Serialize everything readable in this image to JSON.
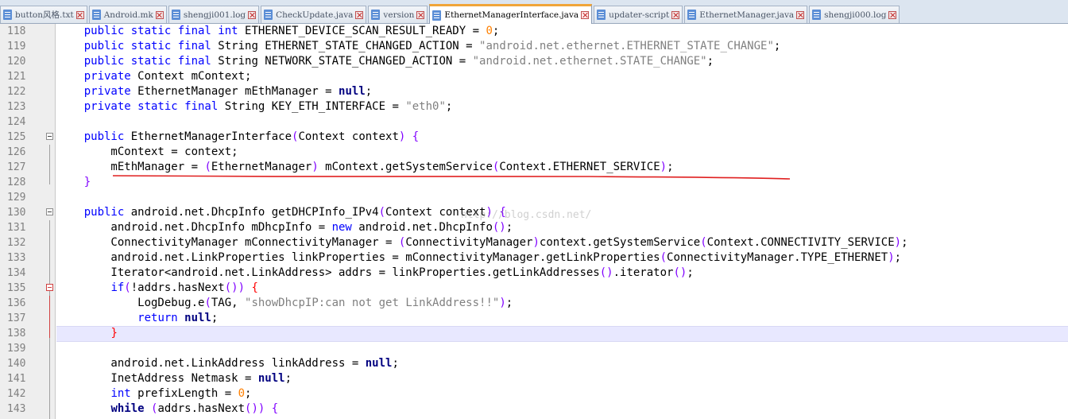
{
  "tabs": [
    {
      "label": "button风格.txt",
      "active": false
    },
    {
      "label": "Android.mk",
      "active": false
    },
    {
      "label": "shengji001.log",
      "active": false
    },
    {
      "label": "CheckUpdate.java",
      "active": false
    },
    {
      "label": "version",
      "active": false
    },
    {
      "label": "EthernetManagerInterface.java",
      "active": true
    },
    {
      "label": "updater-script",
      "active": false
    },
    {
      "label": "EthernetManager.java",
      "active": false
    },
    {
      "label": "shengji000.log",
      "active": false
    }
  ],
  "lines": [
    {
      "n": "118",
      "tokens": [
        [
          "    ",
          ""
        ],
        [
          "public static final int ",
          "k"
        ],
        [
          "ETHERNET_DEVICE_SCAN_RESULT_READY = ",
          ""
        ],
        [
          "0",
          "n"
        ],
        [
          ";",
          ""
        ]
      ]
    },
    {
      "n": "119",
      "tokens": [
        [
          "    ",
          ""
        ],
        [
          "public static final ",
          "k"
        ],
        [
          "String ETHERNET_STATE_CHANGED_ACTION = ",
          ""
        ],
        [
          "\"android.net.ethernet.ETHERNET_STATE_CHANGE\"",
          "s"
        ],
        [
          ";",
          ""
        ]
      ]
    },
    {
      "n": "120",
      "tokens": [
        [
          "    ",
          ""
        ],
        [
          "public static final ",
          "k"
        ],
        [
          "String NETWORK_STATE_CHANGED_ACTION = ",
          ""
        ],
        [
          "\"android.net.ethernet.STATE_CHANGE\"",
          "s"
        ],
        [
          ";",
          ""
        ]
      ]
    },
    {
      "n": "121",
      "tokens": [
        [
          "    ",
          ""
        ],
        [
          "private ",
          "k"
        ],
        [
          "Context mContext;",
          ""
        ]
      ]
    },
    {
      "n": "122",
      "tokens": [
        [
          "    ",
          ""
        ],
        [
          "private ",
          "k"
        ],
        [
          "EthernetManager mEthManager = ",
          ""
        ],
        [
          "null",
          "kb"
        ],
        [
          ";",
          ""
        ]
      ]
    },
    {
      "n": "123",
      "tokens": [
        [
          "    ",
          ""
        ],
        [
          "private static final ",
          "k"
        ],
        [
          "String KEY_ETH_INTERFACE = ",
          ""
        ],
        [
          "\"eth0\"",
          "s"
        ],
        [
          ";",
          ""
        ]
      ]
    },
    {
      "n": "124",
      "tokens": []
    },
    {
      "n": "125",
      "tokens": [
        [
          "    ",
          ""
        ],
        [
          "public ",
          "k"
        ],
        [
          "EthernetManagerInterface",
          ""
        ],
        [
          "(",
          "br"
        ],
        [
          "Context context",
          ""
        ],
        [
          ")",
          "br"
        ],
        [
          " ",
          ""
        ],
        [
          "{",
          "br"
        ]
      ]
    },
    {
      "n": "126",
      "tokens": [
        [
          "        mContext = context;",
          ""
        ]
      ]
    },
    {
      "n": "127",
      "tokens": [
        [
          "        mEthManager = ",
          ""
        ],
        [
          "(",
          "br"
        ],
        [
          "EthernetManager",
          ""
        ],
        [
          ")",
          "br"
        ],
        [
          " mContext.getSystemService",
          ""
        ],
        [
          "(",
          "br"
        ],
        [
          "Context.ETHERNET_SERVICE",
          ""
        ],
        [
          ")",
          "br"
        ],
        [
          ";",
          ""
        ]
      ]
    },
    {
      "n": "128",
      "tokens": [
        [
          "    ",
          ""
        ],
        [
          "}",
          "br"
        ]
      ]
    },
    {
      "n": "129",
      "tokens": []
    },
    {
      "n": "130",
      "tokens": [
        [
          "    ",
          ""
        ],
        [
          "public ",
          "k"
        ],
        [
          "android.net.DhcpInfo getDHCPInfo_IPv4",
          ""
        ],
        [
          "(",
          "br"
        ],
        [
          "Context context",
          ""
        ],
        [
          ")",
          "br"
        ],
        [
          " ",
          ""
        ],
        [
          "{",
          "br"
        ]
      ]
    },
    {
      "n": "131",
      "tokens": [
        [
          "        android.net.DhcpInfo mDhcpInfo = ",
          ""
        ],
        [
          "new ",
          "k"
        ],
        [
          "android.net.DhcpInfo",
          ""
        ],
        [
          "()",
          "br"
        ],
        [
          ";",
          ""
        ]
      ]
    },
    {
      "n": "132",
      "tokens": [
        [
          "        ConnectivityManager mConnectivityManager = ",
          ""
        ],
        [
          "(",
          "br"
        ],
        [
          "ConnectivityManager",
          ""
        ],
        [
          ")",
          "br"
        ],
        [
          "context.getSystemService",
          ""
        ],
        [
          "(",
          "br"
        ],
        [
          "Context.CONNECTIVITY_SERVICE",
          ""
        ],
        [
          ")",
          "br"
        ],
        [
          ";",
          ""
        ]
      ]
    },
    {
      "n": "133",
      "tokens": [
        [
          "        android.net.LinkProperties linkProperties = mConnectivityManager.getLinkProperties",
          ""
        ],
        [
          "(",
          "br"
        ],
        [
          "ConnectivityManager.TYPE_ETHERNET",
          ""
        ],
        [
          ")",
          "br"
        ],
        [
          ";",
          ""
        ]
      ]
    },
    {
      "n": "134",
      "tokens": [
        [
          "        Iterator<android.net.LinkAddress> addrs = linkProperties.getLinkAddresses",
          ""
        ],
        [
          "()",
          "br"
        ],
        [
          ".iterator",
          ""
        ],
        [
          "()",
          "br"
        ],
        [
          ";",
          ""
        ]
      ]
    },
    {
      "n": "135",
      "tokens": [
        [
          "        ",
          ""
        ],
        [
          "if",
          "k"
        ],
        [
          "(",
          "br"
        ],
        [
          "!addrs.hasNext",
          ""
        ],
        [
          "())",
          "br"
        ],
        [
          " ",
          ""
        ],
        [
          "{",
          "redbrace"
        ]
      ]
    },
    {
      "n": "136",
      "tokens": [
        [
          "            LogDebug.e",
          ""
        ],
        [
          "(",
          "br"
        ],
        [
          "TAG, ",
          ""
        ],
        [
          "\"showDhcpIP:can not get LinkAddress!!\"",
          "s"
        ],
        [
          ")",
          "br"
        ],
        [
          ";",
          ""
        ]
      ]
    },
    {
      "n": "137",
      "tokens": [
        [
          "            ",
          ""
        ],
        [
          "return ",
          "k"
        ],
        [
          "null",
          "kb"
        ],
        [
          ";",
          ""
        ]
      ]
    },
    {
      "n": "138",
      "tokens": [
        [
          "        ",
          ""
        ],
        [
          "}",
          "redbrace"
        ]
      ]
    },
    {
      "n": "139",
      "tokens": []
    },
    {
      "n": "140",
      "tokens": [
        [
          "        android.net.LinkAddress linkAddress = ",
          ""
        ],
        [
          "null",
          "kb"
        ],
        [
          ";",
          ""
        ]
      ]
    },
    {
      "n": "141",
      "tokens": [
        [
          "        InetAddress Netmask = ",
          ""
        ],
        [
          "null",
          "kb"
        ],
        [
          ";",
          ""
        ]
      ]
    },
    {
      "n": "142",
      "tokens": [
        [
          "        ",
          ""
        ],
        [
          "int ",
          "k"
        ],
        [
          "prefixLength = ",
          ""
        ],
        [
          "0",
          "n"
        ],
        [
          ";",
          ""
        ]
      ]
    },
    {
      "n": "143",
      "tokens": [
        [
          "        ",
          ""
        ],
        [
          "while ",
          "kb"
        ],
        [
          "(",
          "br"
        ],
        [
          "addrs.hasNext",
          ""
        ],
        [
          "())",
          "br"
        ],
        [
          " ",
          ""
        ],
        [
          "{",
          "br"
        ]
      ]
    }
  ],
  "watermark": "http://blog.csdn.net/",
  "colors": {
    "keyword": "#0000ff",
    "string": "#808080",
    "number": "#ff8000",
    "bracket": "#8000ff",
    "annotation": "#e02020"
  }
}
